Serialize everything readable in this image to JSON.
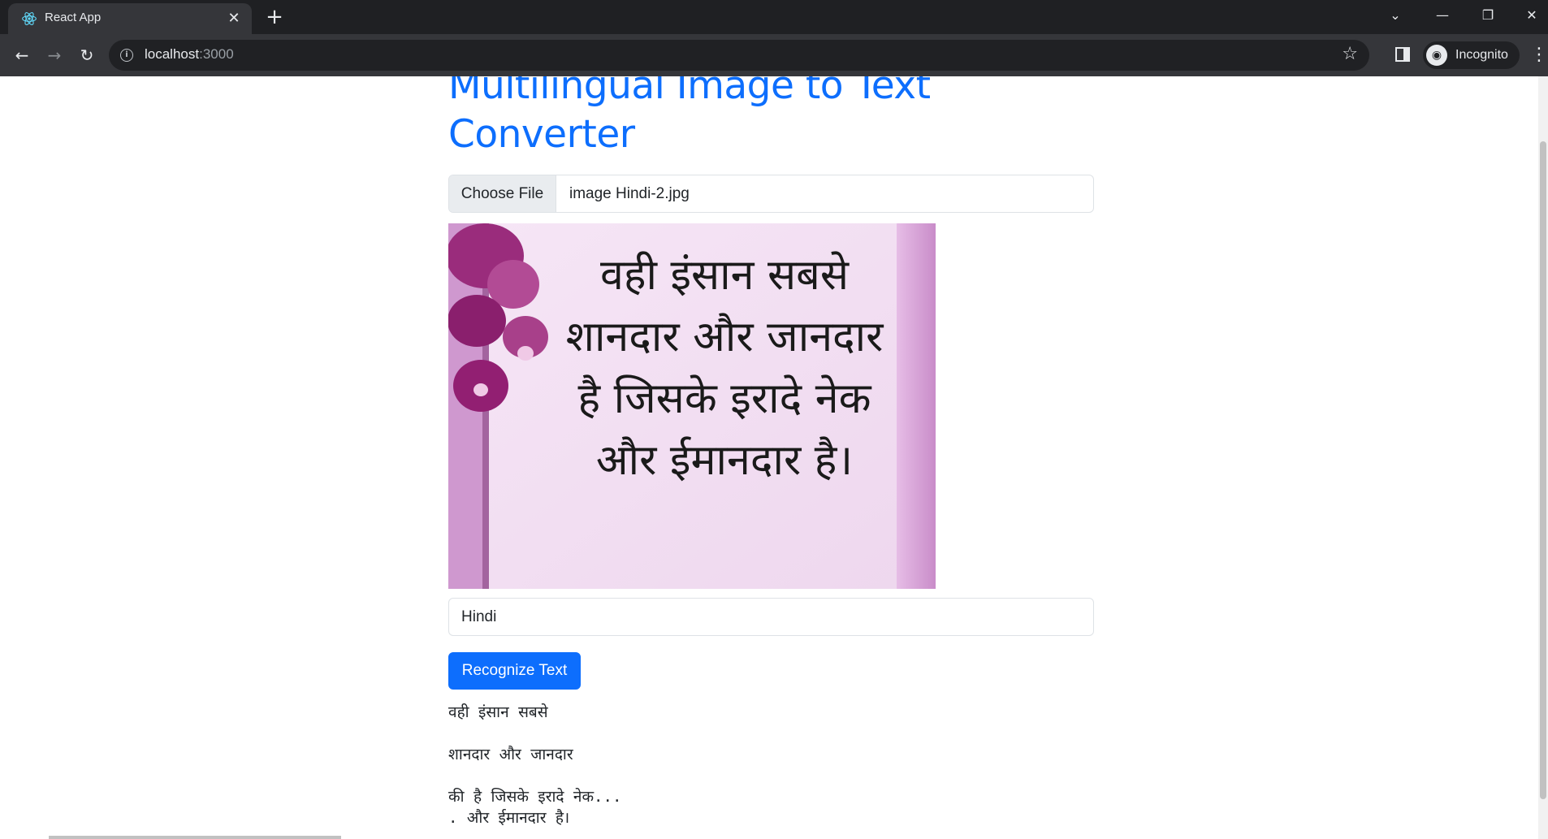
{
  "browser": {
    "tab_title": "React App",
    "url_host": "localhost",
    "url_port": ":3000",
    "profile_label": "Incognito"
  },
  "page": {
    "title_line1": "Multilingual Image to Text",
    "title_line2": "Converter",
    "file_button_label": "Choose File",
    "file_name": "image Hindi-2.jpg",
    "preview_text": [
      "वही इंसान सबसे",
      "शानदार और जानदार",
      "है जिसके इरादे नेक",
      "और ईमानदार है।"
    ],
    "language_value": "Hindi",
    "recognize_label": "Recognize Text",
    "result_lines": [
      "वही इंसान सबसे",
      "शानदार और जानदार",
      "की है जिसके इरादे नेक...",
      ". और ईमानदार है।"
    ]
  },
  "colors": {
    "accent": "#0d6efd",
    "chrome_dark": "#1f2023",
    "chrome_toolbar": "#35363a"
  }
}
